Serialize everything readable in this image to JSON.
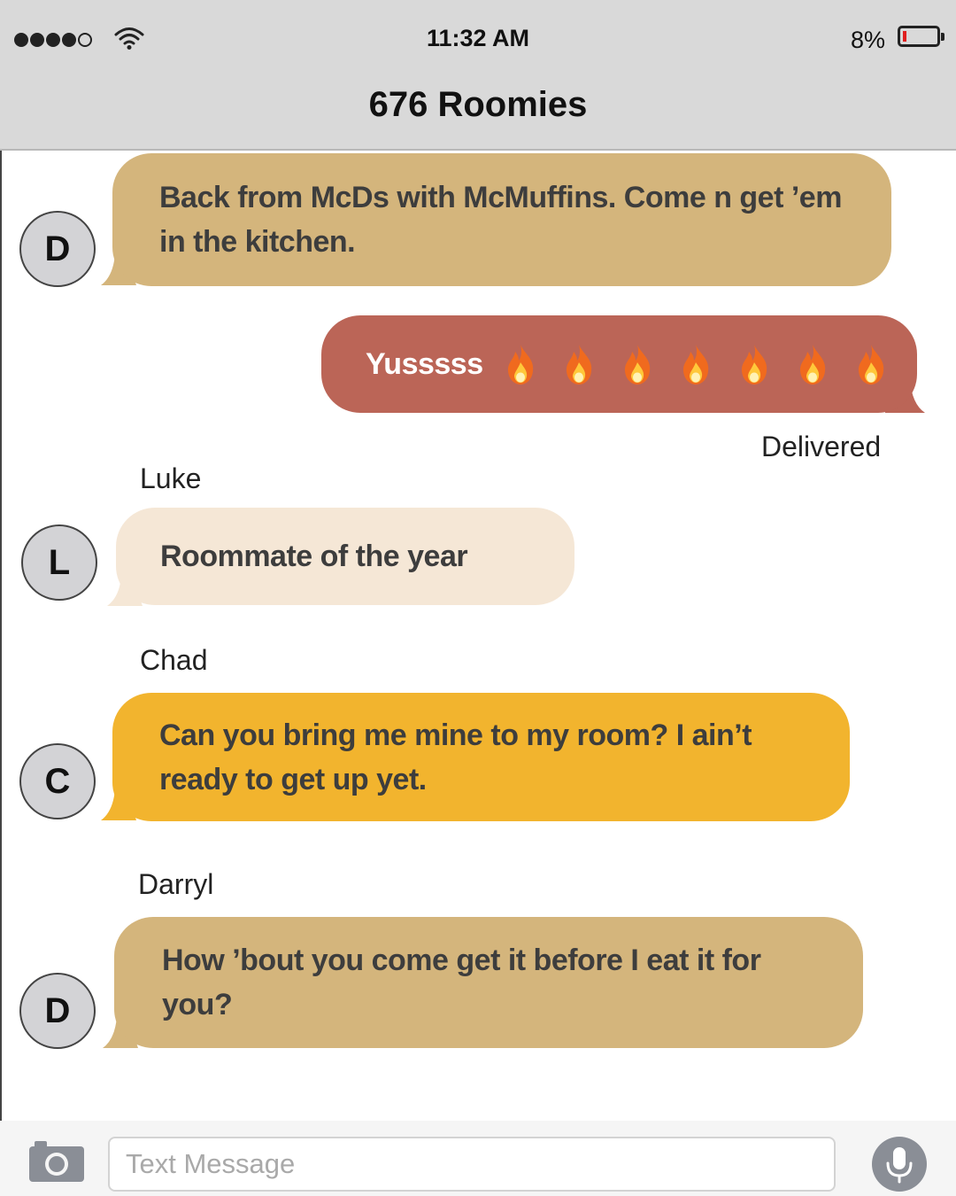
{
  "status_bar": {
    "signal_dots_filled": 4,
    "signal_dots_total": 5,
    "time": "11:32 AM",
    "battery_percent": "8%",
    "battery_level": 0.08
  },
  "conversation": {
    "title": "676 Roomies"
  },
  "messages": [
    {
      "sender": "",
      "avatar_initial": "D",
      "text": "Back from McDs with McMuffins. Come n get ’em in the kitchen.",
      "bubble_color": "#d4b57c",
      "direction": "incoming"
    },
    {
      "sender": "",
      "text": "Yusssss",
      "emoji": "fire",
      "emoji_count": 7,
      "bubble_color": "#bb6557",
      "direction": "outgoing",
      "status": "Delivered"
    },
    {
      "sender": "Luke",
      "avatar_initial": "L",
      "text": "Roommate of the year",
      "bubble_color": "#f5e7d6",
      "direction": "incoming"
    },
    {
      "sender": "Chad",
      "avatar_initial": "C",
      "text": "Can you bring me mine to my room? I ain’t ready to get up yet.",
      "bubble_color": "#f2b42e",
      "direction": "incoming"
    },
    {
      "sender": "Darryl",
      "avatar_initial": "D",
      "text": "How ’bout you come get it before I eat it for you?",
      "bubble_color": "#d4b57c",
      "direction": "incoming"
    }
  ],
  "composer": {
    "placeholder": "Text Message",
    "camera_icon": "camera-icon",
    "mic_icon": "microphone-icon"
  }
}
